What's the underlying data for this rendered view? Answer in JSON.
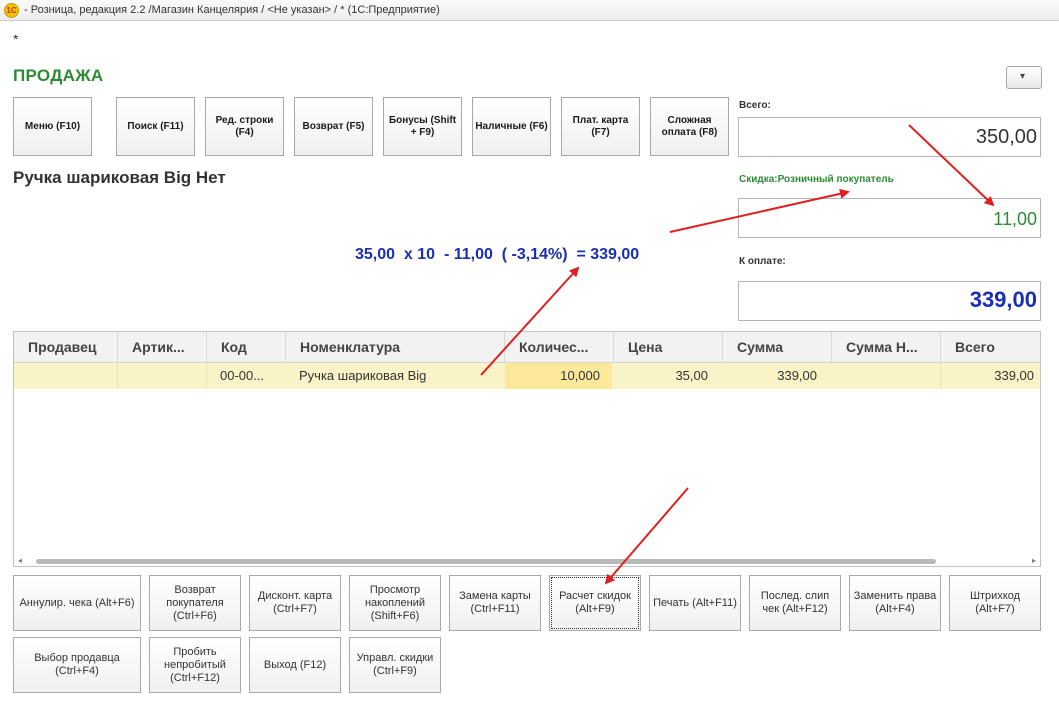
{
  "window": {
    "title": " - Розница, редакция 2.2 /Магазин Канцелярия / <Не указан> / * (1С:Предприятие)",
    "modified_marker": "*",
    "app_icon": "1c-app-icon"
  },
  "header": {
    "title": "ПРОДАЖА",
    "menu_dropdown": "chevron-down-icon"
  },
  "toolbar": [
    {
      "label": "Меню (F10)"
    },
    {
      "label": "Поиск (F11)"
    },
    {
      "label": "Ред. строки (F4)"
    },
    {
      "label": "Возврат (F5)"
    },
    {
      "label": "Бонусы (Shift + F9)"
    },
    {
      "label": "Наличные (F6)"
    },
    {
      "label": "Плат. карта (F7)"
    },
    {
      "label": "Сложная оплата (F8)"
    }
  ],
  "current_item": {
    "name": "Ручка шариковая Big Нет"
  },
  "totals": {
    "total_label": "Всего:",
    "total_value": "350,00",
    "discount_label": "Скидка:Розничный покупатель",
    "discount_value": "11,00",
    "to_pay_label": "К оплате:",
    "to_pay_value": "339,00"
  },
  "formula": "35,00  x 10  - 11,00  ( -3,14%)  = 339,00",
  "table": {
    "columns": [
      "Продавец",
      "Артик...",
      "Код",
      "Номенклатура",
      "Количес...",
      "Цена",
      "Сумма",
      "Сумма Н...",
      "Всего"
    ],
    "rows": [
      {
        "seller": "",
        "article": "",
        "code": "00-00...",
        "item": "Ручка шариковая Big",
        "qty": "10,000",
        "price": "35,00",
        "sum": "339,00",
        "sum_n": "",
        "total": "339,00"
      }
    ]
  },
  "bottom_buttons": [
    {
      "label": "Аннулир. чека (Alt+F6)"
    },
    {
      "label": "Возврат покупателя (Ctrl+F6)"
    },
    {
      "label": "Дисконт. карта (Ctrl+F7)"
    },
    {
      "label": "Просмотр накоплений (Shift+F6)"
    },
    {
      "label": "Замена карты (Ctrl+F11)"
    },
    {
      "label": "Расчет скидок (Alt+F9)"
    },
    {
      "label": "Печать (Alt+F11)"
    },
    {
      "label": "Послед. слип чек (Alt+F12)"
    },
    {
      "label": "Заменить права (Alt+F4)"
    },
    {
      "label": "Штрихкод (Alt+F7)"
    },
    {
      "label": "Выбор продавца (Ctrl+F4)"
    },
    {
      "label": "Пробить непробитый (Ctrl+F12)"
    },
    {
      "label": "Выход (F12)"
    },
    {
      "label": "Управл. скидки (Ctrl+F9)"
    }
  ],
  "colors": {
    "title_green": "#2e8b34",
    "discount_green": "#2e8b34",
    "pay_blue": "#1a2fb3",
    "row_highlight": "#fbf3c8",
    "qty_highlight": "#fde99a",
    "annotation_red": "#e02020"
  }
}
